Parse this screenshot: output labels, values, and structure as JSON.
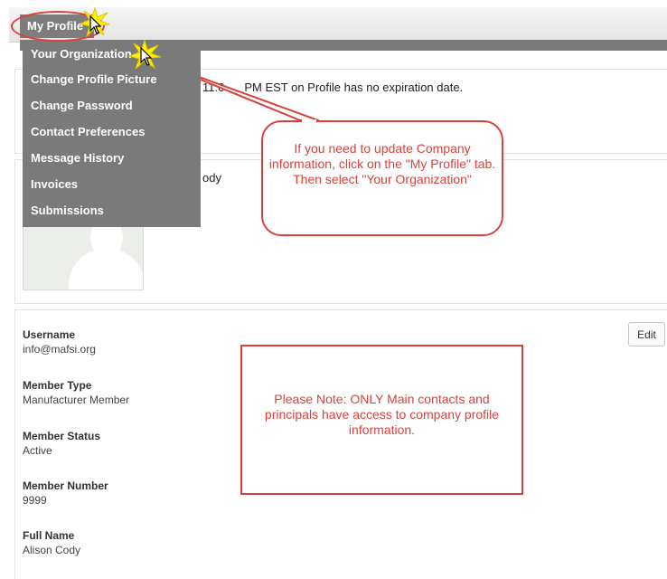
{
  "nav": {
    "my_profile": "My Profile"
  },
  "dropdown": {
    "items": [
      "Your Organization",
      "Change Profile Picture",
      "Change Password",
      "Contact Preferences",
      "Message History",
      "Invoices",
      "Submissions"
    ]
  },
  "expiration": {
    "partial": "11:0",
    "text": "PM EST on Profile has no expiration date."
  },
  "name_fragment": "ody",
  "callout": {
    "text": "If you need to update Company information, click on the \"My Profile\" tab. Then select \"Your Organization\""
  },
  "note": {
    "text": "Please Note: ONLY Main contacts and principals have access to company profile information."
  },
  "profile": {
    "edit_label": "Edit",
    "fields": [
      {
        "label": "Username",
        "value": "info@mafsi.org"
      },
      {
        "label": "Member Type",
        "value": "Manufacturer Member"
      },
      {
        "label": "Member Status",
        "value": "Active"
      },
      {
        "label": "Member Number",
        "value": "9999"
      },
      {
        "label": "Full Name",
        "value": "Alison Cody"
      }
    ]
  },
  "colors": {
    "annotation_red": "#d9423b",
    "menu_gray": "#7a7a7a"
  },
  "icons": [
    "cursor-arrow-icon",
    "highlight-star-icon",
    "avatar-placeholder-icon"
  ]
}
